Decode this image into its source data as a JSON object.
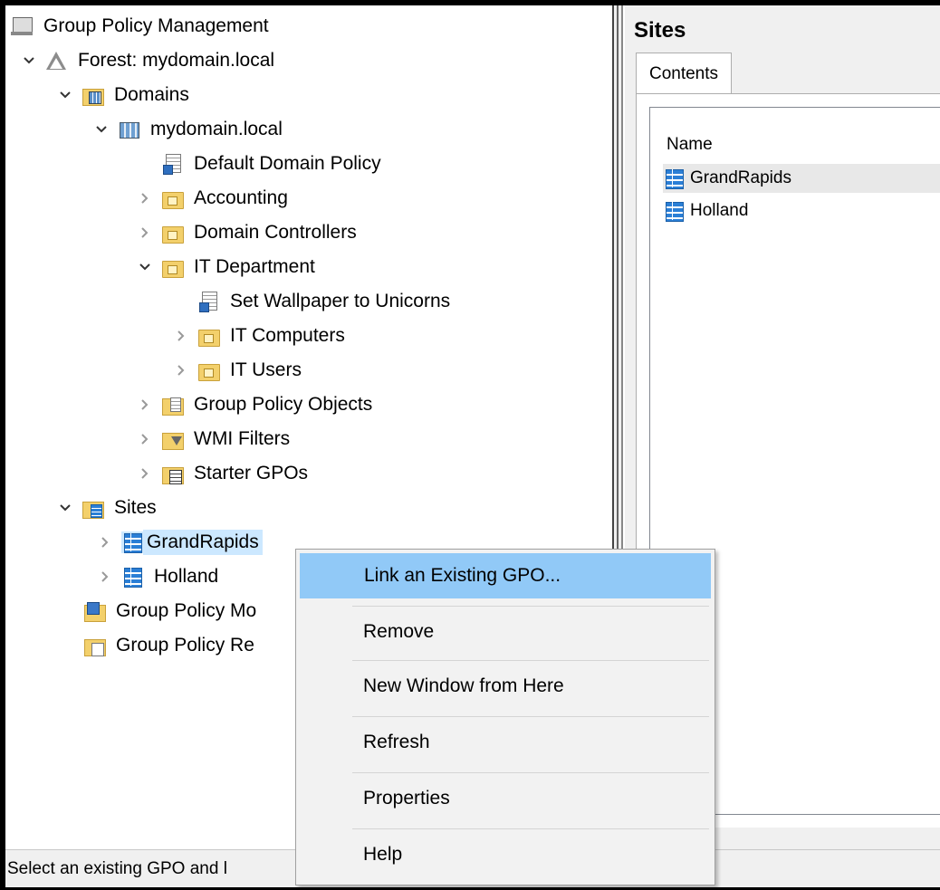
{
  "tree": {
    "items": [
      {
        "label": "Group Policy Management",
        "icon": "gpm-console-icon"
      },
      {
        "label": "Forest: mydomain.local",
        "icon": "forest-icon",
        "expander": "chevron-down"
      },
      {
        "label": "Domains",
        "icon": "domains-folder-icon",
        "expander": "chevron-down"
      },
      {
        "label": "mydomain.local",
        "icon": "domain-icon",
        "expander": "chevron-down"
      },
      {
        "label": "Default Domain Policy",
        "icon": "gpo-link-icon"
      },
      {
        "label": "Accounting",
        "icon": "ou-folder-icon",
        "expander": "chevron-right"
      },
      {
        "label": "Domain Controllers",
        "icon": "ou-folder-icon",
        "expander": "chevron-right"
      },
      {
        "label": "IT Department",
        "icon": "ou-folder-icon",
        "expander": "chevron-down"
      },
      {
        "label": "Set Wallpaper to Unicorns",
        "icon": "gpo-link-icon"
      },
      {
        "label": "IT Computers",
        "icon": "ou-folder-icon",
        "expander": "chevron-right"
      },
      {
        "label": "IT Users",
        "icon": "ou-folder-icon",
        "expander": "chevron-right"
      },
      {
        "label": "Group Policy Objects",
        "icon": "gpo-folder-icon",
        "expander": "chevron-right"
      },
      {
        "label": "WMI Filters",
        "icon": "wmi-filter-folder-icon",
        "expander": "chevron-right"
      },
      {
        "label": "Starter GPOs",
        "icon": "starter-gpo-folder-icon",
        "expander": "chevron-right"
      },
      {
        "label": "Sites",
        "icon": "sites-folder-icon",
        "expander": "chevron-down"
      },
      {
        "label": "GrandRapids",
        "icon": "site-icon",
        "expander": "chevron-right",
        "selected": true
      },
      {
        "label": "Holland",
        "icon": "site-icon",
        "expander": "chevron-right"
      },
      {
        "label": "Group Policy Mo",
        "icon": "gp-modeling-icon"
      },
      {
        "label": "Group Policy Re",
        "icon": "gp-results-icon"
      }
    ]
  },
  "right_pane": {
    "title": "Sites",
    "tab": "Contents",
    "column_header": "Name",
    "items": [
      {
        "label": "GrandRapids",
        "icon": "site-icon",
        "highlighted": true
      },
      {
        "label": "Holland",
        "icon": "site-icon"
      }
    ]
  },
  "context_menu": {
    "items": [
      {
        "label": "Link an Existing GPO...",
        "active": true
      },
      {
        "label": "Remove"
      },
      {
        "label": "New Window from Here"
      },
      {
        "label": "Refresh"
      },
      {
        "label": "Properties"
      },
      {
        "label": "Help"
      }
    ]
  },
  "status_bar": {
    "text": "Select an existing GPO and l"
  },
  "colors": {
    "selection": "#cce8ff",
    "menu_highlight": "#91c9f7",
    "menu_bg": "#f2f2f2"
  }
}
